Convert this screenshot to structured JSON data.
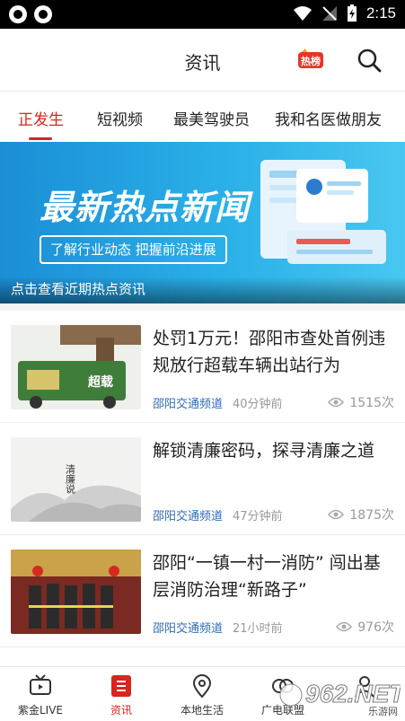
{
  "status_bar": {
    "time": "2:15"
  },
  "header": {
    "title": "资讯",
    "hot_badge_label": "热榜"
  },
  "tabs": [
    {
      "label": "正发生",
      "active": true
    },
    {
      "label": "短视频",
      "active": false
    },
    {
      "label": "最美驾驶员",
      "active": false
    },
    {
      "label": "我和名医做朋友",
      "active": false
    }
  ],
  "banner": {
    "title": "最新热点新闻",
    "subtitle": "了解行业动态 把握前沿进展",
    "caption": "点击查看近期热点资讯"
  },
  "news": [
    {
      "title": "处罚1万元！邵阳市查处首例违规放行超载车辆出站行为",
      "source": "邵阳交通频道",
      "time": "40分钟前",
      "views": "1515次",
      "thumb_text": "超载"
    },
    {
      "title": "解锁清廉密码，探寻清廉之道",
      "source": "邵阳交通频道",
      "time": "47分钟前",
      "views": "1875次",
      "thumb_text": "清廉说"
    },
    {
      "title": "邵阳“一镇一村一消防” 闯出基层消防治理“新路子”",
      "source": "邵阳交通频道",
      "time": "21小时前",
      "views": "976次",
      "thumb_text": ""
    }
  ],
  "bottom_nav": [
    {
      "label": "紫金LIVE",
      "icon": "tv-icon",
      "active": false
    },
    {
      "label": "资讯",
      "icon": "news-icon",
      "active": true
    },
    {
      "label": "本地生活",
      "icon": "location-pin-icon",
      "active": false
    },
    {
      "label": "广电联盟",
      "icon": "alliance-icon",
      "active": false
    },
    {
      "label": "",
      "icon": "profile-icon",
      "active": false
    }
  ],
  "watermark": {
    "text": "962.NET",
    "subtext": "乐游网"
  },
  "colors": {
    "accent": "#d7261e",
    "source_link": "#2f6db5",
    "banner": "#1b8ed6"
  }
}
